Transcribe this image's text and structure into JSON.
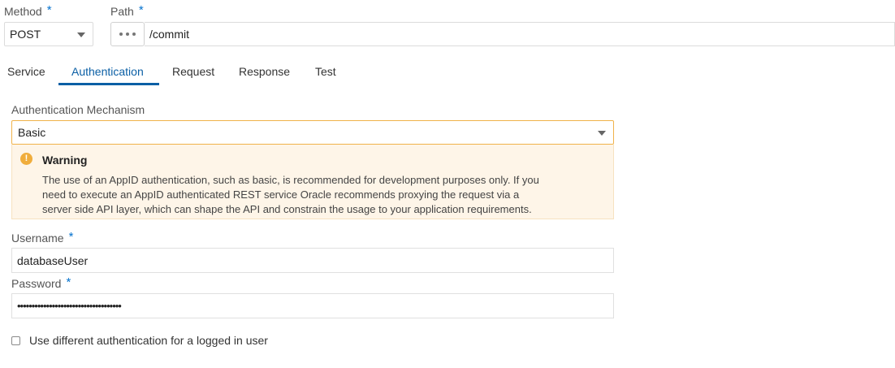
{
  "method": {
    "label": "Method",
    "value": "POST"
  },
  "path": {
    "label": "Path",
    "value": "/commit",
    "dots": "•••"
  },
  "tabs": [
    "Service",
    "Authentication",
    "Request",
    "Response",
    "Test"
  ],
  "active_tab": "Authentication",
  "auth": {
    "label": "Authentication Mechanism",
    "value": "Basic"
  },
  "warning": {
    "icon": "!",
    "title": "Warning",
    "line1": "The use of an AppID authentication, such as basic, is recommended for development purposes only. If you",
    "line2": "need to execute an AppID authenticated REST service Oracle recommends proxying the request via a",
    "line3": "server side API layer, which can shape the API and constrain the usage to your application requirements."
  },
  "username": {
    "label": "Username",
    "value": "databaseUser"
  },
  "password": {
    "label": "Password",
    "value": "••••••••••••••••••••••••••••••••••••"
  },
  "required_mark": "*",
  "checkbox": {
    "label": "Use different authentication for a logged in user",
    "checked": false
  },
  "colors": {
    "accent": "#0b5fa5",
    "warning_bg": "#fef5e8",
    "warning_icon": "#f0ad3c",
    "focus_border": "#f0b24a"
  }
}
